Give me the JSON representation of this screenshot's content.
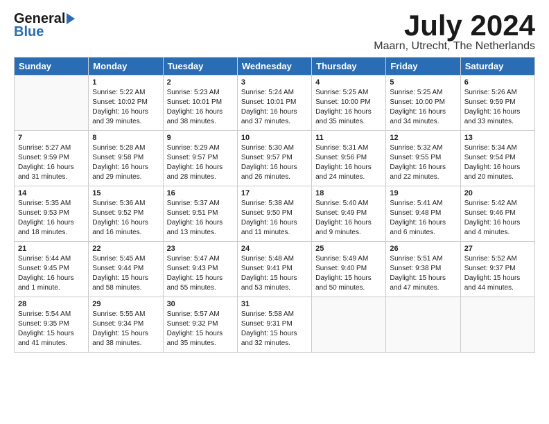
{
  "logo": {
    "general": "General",
    "blue": "Blue"
  },
  "title": "July 2024",
  "location": "Maarn, Utrecht, The Netherlands",
  "days_of_week": [
    "Sunday",
    "Monday",
    "Tuesday",
    "Wednesday",
    "Thursday",
    "Friday",
    "Saturday"
  ],
  "weeks": [
    [
      {
        "day": "",
        "info": ""
      },
      {
        "day": "1",
        "info": "Sunrise: 5:22 AM\nSunset: 10:02 PM\nDaylight: 16 hours\nand 39 minutes."
      },
      {
        "day": "2",
        "info": "Sunrise: 5:23 AM\nSunset: 10:01 PM\nDaylight: 16 hours\nand 38 minutes."
      },
      {
        "day": "3",
        "info": "Sunrise: 5:24 AM\nSunset: 10:01 PM\nDaylight: 16 hours\nand 37 minutes."
      },
      {
        "day": "4",
        "info": "Sunrise: 5:25 AM\nSunset: 10:00 PM\nDaylight: 16 hours\nand 35 minutes."
      },
      {
        "day": "5",
        "info": "Sunrise: 5:25 AM\nSunset: 10:00 PM\nDaylight: 16 hours\nand 34 minutes."
      },
      {
        "day": "6",
        "info": "Sunrise: 5:26 AM\nSunset: 9:59 PM\nDaylight: 16 hours\nand 33 minutes."
      }
    ],
    [
      {
        "day": "7",
        "info": "Sunrise: 5:27 AM\nSunset: 9:59 PM\nDaylight: 16 hours\nand 31 minutes."
      },
      {
        "day": "8",
        "info": "Sunrise: 5:28 AM\nSunset: 9:58 PM\nDaylight: 16 hours\nand 29 minutes."
      },
      {
        "day": "9",
        "info": "Sunrise: 5:29 AM\nSunset: 9:57 PM\nDaylight: 16 hours\nand 28 minutes."
      },
      {
        "day": "10",
        "info": "Sunrise: 5:30 AM\nSunset: 9:57 PM\nDaylight: 16 hours\nand 26 minutes."
      },
      {
        "day": "11",
        "info": "Sunrise: 5:31 AM\nSunset: 9:56 PM\nDaylight: 16 hours\nand 24 minutes."
      },
      {
        "day": "12",
        "info": "Sunrise: 5:32 AM\nSunset: 9:55 PM\nDaylight: 16 hours\nand 22 minutes."
      },
      {
        "day": "13",
        "info": "Sunrise: 5:34 AM\nSunset: 9:54 PM\nDaylight: 16 hours\nand 20 minutes."
      }
    ],
    [
      {
        "day": "14",
        "info": "Sunrise: 5:35 AM\nSunset: 9:53 PM\nDaylight: 16 hours\nand 18 minutes."
      },
      {
        "day": "15",
        "info": "Sunrise: 5:36 AM\nSunset: 9:52 PM\nDaylight: 16 hours\nand 16 minutes."
      },
      {
        "day": "16",
        "info": "Sunrise: 5:37 AM\nSunset: 9:51 PM\nDaylight: 16 hours\nand 13 minutes."
      },
      {
        "day": "17",
        "info": "Sunrise: 5:38 AM\nSunset: 9:50 PM\nDaylight: 16 hours\nand 11 minutes."
      },
      {
        "day": "18",
        "info": "Sunrise: 5:40 AM\nSunset: 9:49 PM\nDaylight: 16 hours\nand 9 minutes."
      },
      {
        "day": "19",
        "info": "Sunrise: 5:41 AM\nSunset: 9:48 PM\nDaylight: 16 hours\nand 6 minutes."
      },
      {
        "day": "20",
        "info": "Sunrise: 5:42 AM\nSunset: 9:46 PM\nDaylight: 16 hours\nand 4 minutes."
      }
    ],
    [
      {
        "day": "21",
        "info": "Sunrise: 5:44 AM\nSunset: 9:45 PM\nDaylight: 16 hours\nand 1 minute."
      },
      {
        "day": "22",
        "info": "Sunrise: 5:45 AM\nSunset: 9:44 PM\nDaylight: 15 hours\nand 58 minutes."
      },
      {
        "day": "23",
        "info": "Sunrise: 5:47 AM\nSunset: 9:43 PM\nDaylight: 15 hours\nand 55 minutes."
      },
      {
        "day": "24",
        "info": "Sunrise: 5:48 AM\nSunset: 9:41 PM\nDaylight: 15 hours\nand 53 minutes."
      },
      {
        "day": "25",
        "info": "Sunrise: 5:49 AM\nSunset: 9:40 PM\nDaylight: 15 hours\nand 50 minutes."
      },
      {
        "day": "26",
        "info": "Sunrise: 5:51 AM\nSunset: 9:38 PM\nDaylight: 15 hours\nand 47 minutes."
      },
      {
        "day": "27",
        "info": "Sunrise: 5:52 AM\nSunset: 9:37 PM\nDaylight: 15 hours\nand 44 minutes."
      }
    ],
    [
      {
        "day": "28",
        "info": "Sunrise: 5:54 AM\nSunset: 9:35 PM\nDaylight: 15 hours\nand 41 minutes."
      },
      {
        "day": "29",
        "info": "Sunrise: 5:55 AM\nSunset: 9:34 PM\nDaylight: 15 hours\nand 38 minutes."
      },
      {
        "day": "30",
        "info": "Sunrise: 5:57 AM\nSunset: 9:32 PM\nDaylight: 15 hours\nand 35 minutes."
      },
      {
        "day": "31",
        "info": "Sunrise: 5:58 AM\nSunset: 9:31 PM\nDaylight: 15 hours\nand 32 minutes."
      },
      {
        "day": "",
        "info": ""
      },
      {
        "day": "",
        "info": ""
      },
      {
        "day": "",
        "info": ""
      }
    ]
  ]
}
